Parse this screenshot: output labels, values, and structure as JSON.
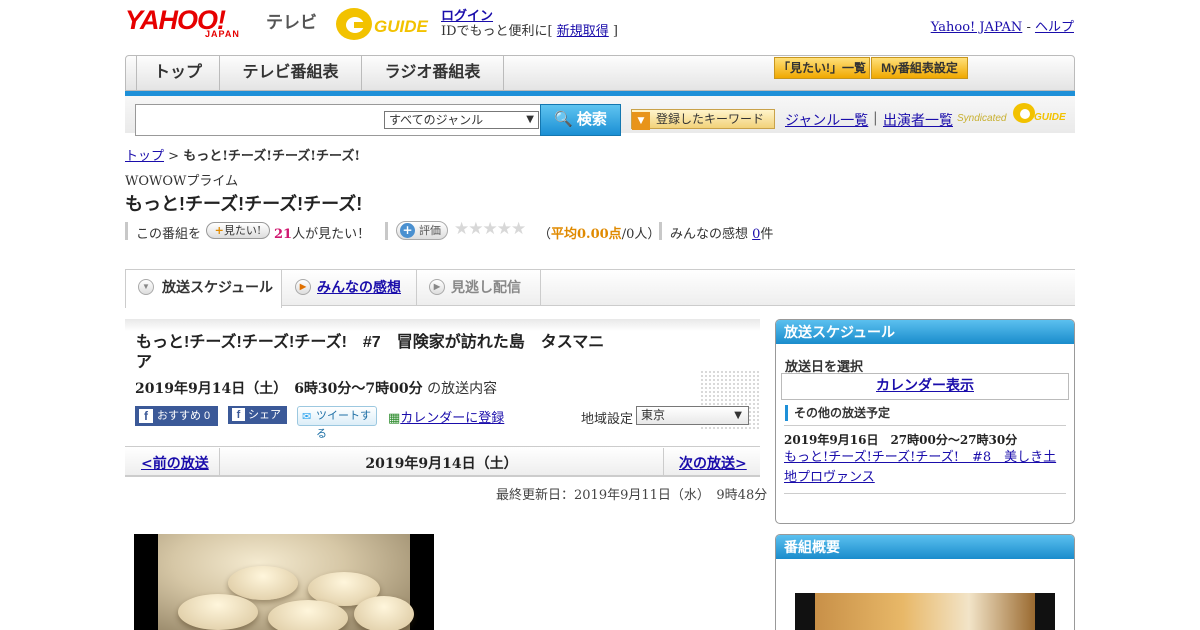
{
  "header": {
    "logo_yahoo": "YAHOO!",
    "logo_japan": "JAPAN",
    "logo_tv": "テレビ",
    "login_label": "ログイン",
    "login_sub_prefix": "IDでもっと便利に[ ",
    "signup_label": "新規取得",
    "login_sub_suffix": " ]",
    "yahoo_japan_link": "Yahoo! JAPAN",
    "dash": " - ",
    "help_link": "ヘルプ"
  },
  "nav": {
    "tabs": [
      "トップ",
      "テレビ番組表",
      "ラジオ番組表"
    ],
    "mitai_list": "「見たい!」一覧",
    "my_settings": "My番組表設定"
  },
  "search": {
    "genre_selected": "すべてのジャンル",
    "search_button": "検索",
    "keyword_button": "登録したキーワード",
    "genre_list_link": "ジャンル一覧",
    "separator": "|",
    "cast_list_link": "出演者一覧",
    "syndicated": "Syndicated"
  },
  "program": {
    "breadcrumb_top": "トップ",
    "breadcrumb_sep": " > ",
    "breadcrumb_current": "もっと!チーズ!チーズ!チーズ!",
    "channel": "WOWOWプライム",
    "title": "もっと!チーズ!チーズ!チーズ!",
    "mitai_prefix": "この番組を",
    "mitai_button": "見たい!",
    "mitai_count": "21",
    "mitai_suffix": "人が見たい！",
    "rate_button": "評価",
    "stars": "★★★★★",
    "avg_open": "（",
    "avg_label": "平均0.00点",
    "avg_rest": "/0人）",
    "comments_prefix": "みんなの感想 ",
    "comments_count": "0",
    "comments_suffix": "件"
  },
  "tabs": {
    "schedule": "放送スケジュール",
    "reviews": "みんなの感想",
    "streaming": "見逃し配信"
  },
  "episode": {
    "title": "もっと!チーズ!チーズ!チーズ!　#7　冒険家が訪れた島　タスマニア",
    "date": "2019年9月14日（土）　6時30分～7時00分",
    "date_suffix": " の放送内容",
    "fb_recommend": "おすすめ 0",
    "fb_share": "シェア",
    "tweet": "ツイートする",
    "calendar_register": "カレンダーに登録",
    "region_label": "地域設定",
    "region_selected": "東京",
    "prev_link": "<前の放送",
    "nav_date": "2019年9月14日（土）",
    "next_link": "次の放送>",
    "updated": "最終更新日：2019年9月11日（水）　9時48分"
  },
  "sidebar": {
    "schedule_head": "放送スケジュール",
    "select_date": "放送日を選択",
    "calendar_button": "カレンダー表示",
    "other_label": "その他の放送予定",
    "other_date": "2019年9月16日　27時00分～27時30分",
    "other_link": "もっと!チーズ!チーズ!チーズ!　#8　美しき土地プロヴァンス",
    "overview_head": "番組概要"
  },
  "colors": {
    "accent_blue": "#1e90d8",
    "yahoo_red": "#e60000",
    "gguide_yellow": "#f2c200",
    "mitai_pink": "#d01870",
    "avg_orange": "#e08a00"
  },
  "icons": [
    "search-icon",
    "triangle-down-icon",
    "star-icon",
    "plus-icon",
    "calendar-icon",
    "facebook-icon",
    "twitter-icon",
    "play-circle-icon"
  ]
}
